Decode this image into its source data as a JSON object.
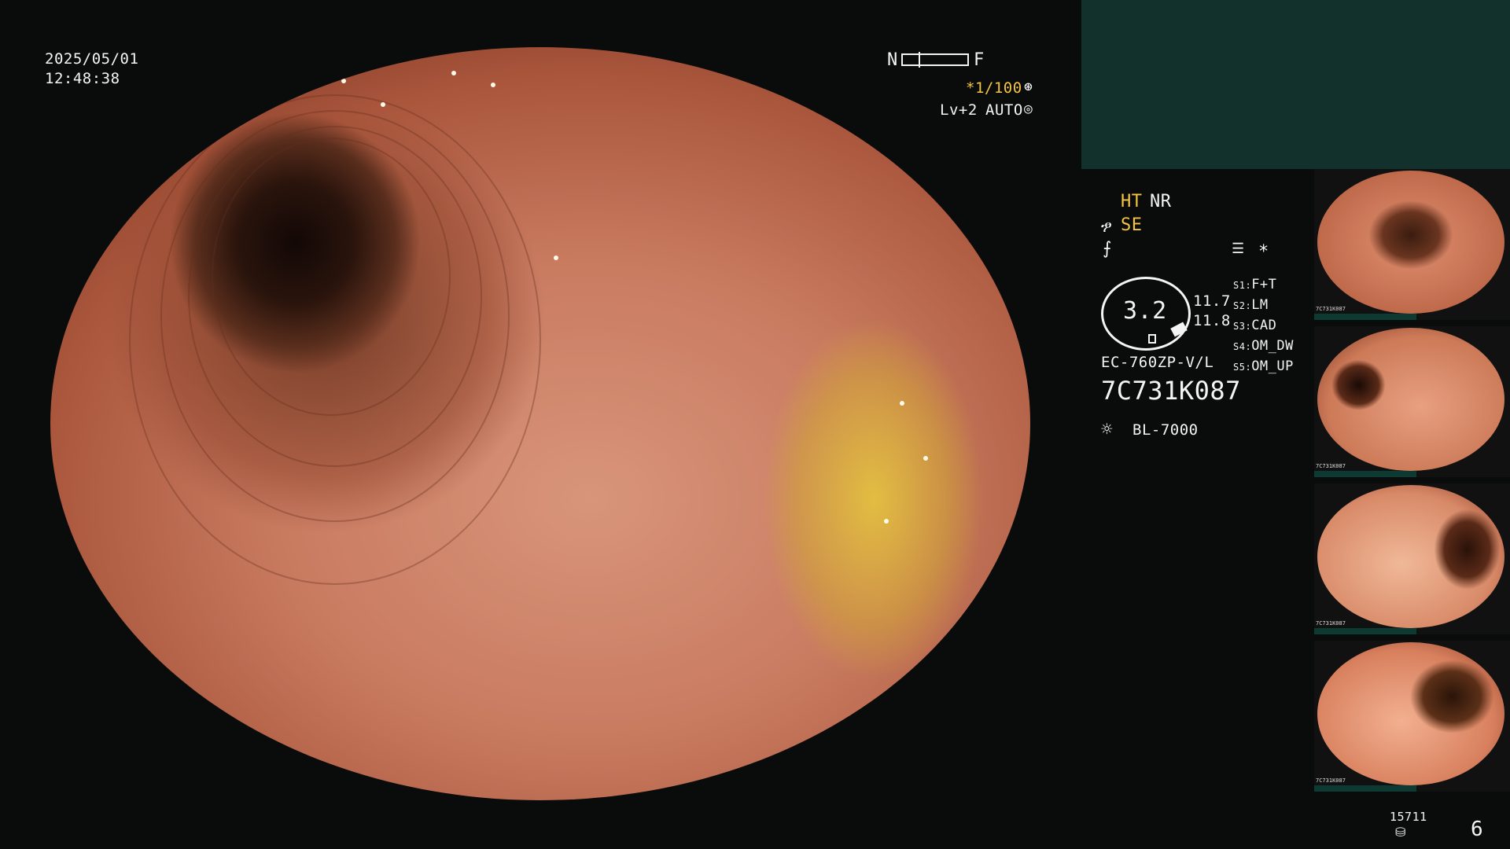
{
  "datetime": {
    "date": "2025/05/01",
    "time": "12:48:38"
  },
  "header": {
    "focus_near": "N",
    "focus_far": "F",
    "shutter": "*1/100",
    "level": "Lv+2",
    "mode": "AUTO"
  },
  "settings": {
    "ht": "HT",
    "nr": "NR",
    "se": "SE",
    "zoom_value": "3.2",
    "value_1": "11.7",
    "value_2": "11.8",
    "asterisk": "*",
    "scope_model": "EC-760ZP-V/L",
    "scope_serial": "7C731K087",
    "light_source": "BL-7000"
  },
  "switches": [
    {
      "key": "S1:",
      "value": "F+T"
    },
    {
      "key": "S2:",
      "value": "LM"
    },
    {
      "key": "S3:",
      "value": "CAD"
    },
    {
      "key": "S4:",
      "value": "OM_DW"
    },
    {
      "key": "S5:",
      "value": "OM_UP"
    }
  ],
  "thumbnail_tag": "7C731K087",
  "footer": {
    "counter": "15711",
    "page": "6"
  },
  "colors": {
    "accent_yellow": "#f5c542",
    "panel_teal": "#12302c"
  },
  "icons": [
    "fan-icon",
    "target-icon",
    "gear-icon",
    "sun-icon",
    "database-icon",
    "settings-list-icon"
  ]
}
